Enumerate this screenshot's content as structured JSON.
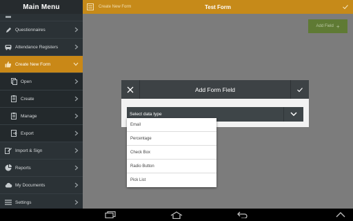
{
  "sidebar": {
    "header": "Main Menu",
    "items": [
      {
        "label": "Questionnaires",
        "icon": "pencil-icon"
      },
      {
        "label": "Attendance Registers",
        "icon": "bus-icon"
      },
      {
        "label": "Create New Form",
        "icon": "thumbs-up-icon"
      },
      {
        "label": "Open",
        "icon": "copy-icon"
      },
      {
        "label": "Create",
        "icon": "clipboard-icon"
      },
      {
        "label": "Manage",
        "icon": "clipboard-icon"
      },
      {
        "label": "Export",
        "icon": "export-icon"
      },
      {
        "label": "Import & Sign",
        "icon": "pencil-icon"
      },
      {
        "label": "Reports",
        "icon": "pie-chart-icon"
      },
      {
        "label": "My Documents",
        "icon": "cloud-icon"
      },
      {
        "label": "Settings",
        "icon": "menu-icon"
      }
    ]
  },
  "topbar": {
    "breadcrumb": "Create New Form",
    "title": "Test Form"
  },
  "add_field": {
    "label": "Add Field",
    "plus": "+"
  },
  "dialog": {
    "title": "Add Form Field",
    "select_value": "Select data type"
  },
  "dropdown": {
    "options": [
      "Email",
      "Percentage",
      "Check Box",
      "Radio Button",
      "Pick List"
    ]
  },
  "colors": {
    "accent": "#c98817",
    "sidebar_bg": "#2b3236",
    "dialog_header": "#3d4245",
    "add_button": "#5f7a34"
  }
}
